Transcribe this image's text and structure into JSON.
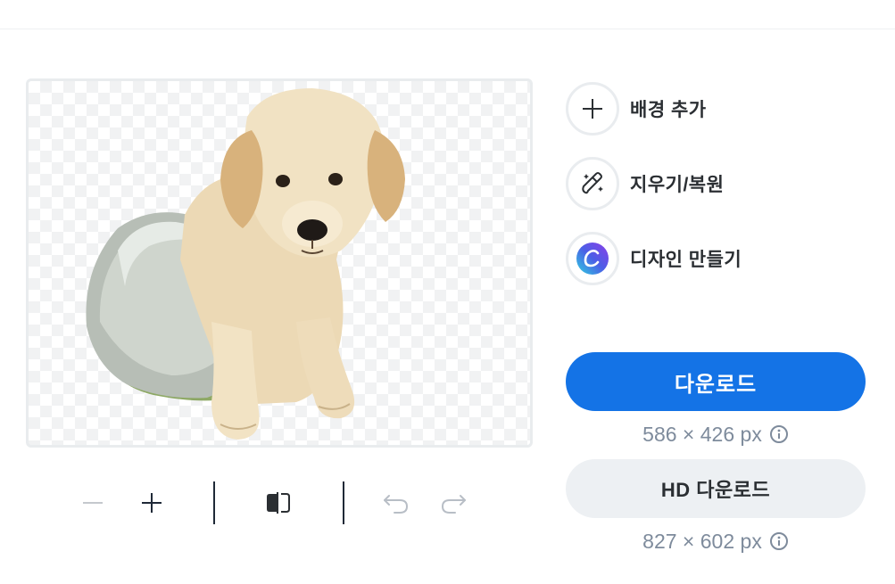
{
  "preview": {
    "subject_alt": "puppy in a metal bowl (background removed)"
  },
  "toolbar": {
    "zoom_out_icon": "minus-icon",
    "zoom_in_icon": "plus-icon",
    "compare_icon": "compare-toggle-icon",
    "undo_icon": "undo-icon",
    "redo_icon": "redo-icon"
  },
  "side_actions": [
    {
      "label": "배경 추가",
      "icon": "plus-icon"
    },
    {
      "label": "지우기/복원",
      "icon": "magic-brush-icon"
    },
    {
      "label": "디자인 만들기",
      "icon": "canva-logo-icon"
    }
  ],
  "download": {
    "label": "다운로드",
    "size": "586 × 426 px"
  },
  "hd_download": {
    "label": "HD 다운로드",
    "size": "827 × 602 px"
  },
  "colors": {
    "primary": "#1473e6",
    "secondary_bg": "#edf0f3",
    "size_text": "#7e8b9c"
  }
}
